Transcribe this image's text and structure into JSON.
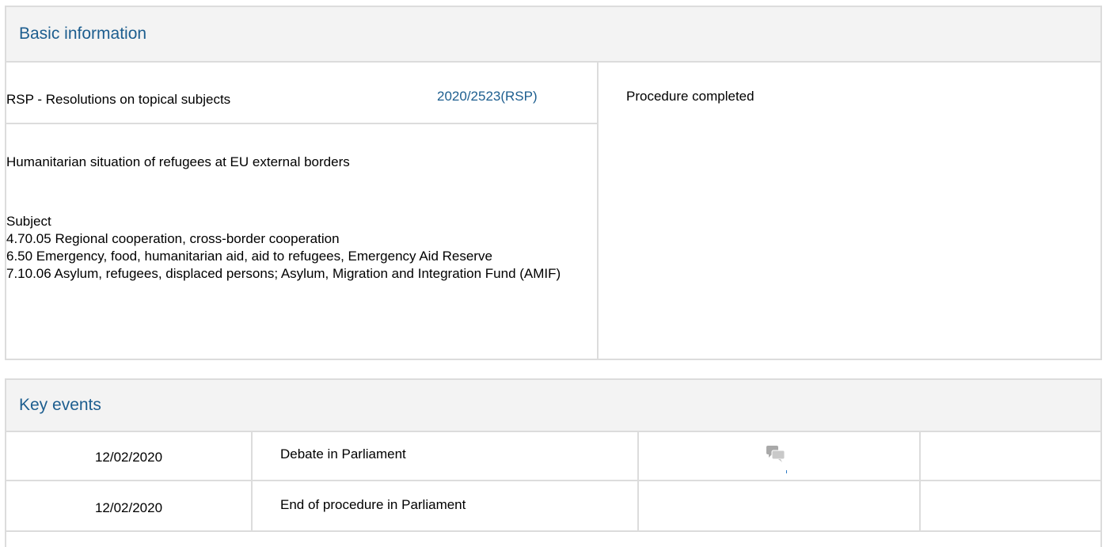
{
  "basic_information": {
    "header": "Basic information",
    "procedure_type": "RSP - Resolutions on topical subjects",
    "reference": "2020/2523(RSP)",
    "status": "Procedure completed",
    "title": "Humanitarian situation of refugees at EU external borders",
    "subject_label": "Subject",
    "subjects": [
      "4.70.05 Regional cooperation, cross-border cooperation",
      "6.50 Emergency, food, humanitarian aid, aid to refugees, Emergency Aid Reserve",
      "7.10.06 Asylum, refugees, displaced persons; Asylum, Migration and Integration Fund (AMIF)"
    ]
  },
  "key_events": {
    "header": "Key events",
    "rows": [
      {
        "date": "12/02/2020",
        "event": "Debate in Parliament",
        "document_icon": "debate-speech-bubbles-icon"
      },
      {
        "date": "12/02/2020",
        "event": "End of procedure in Parliament",
        "document_icon": ""
      }
    ]
  },
  "colors": {
    "accent": "#1d5e8f",
    "header_bg": "#f3f3f3",
    "border": "#dcdcdc"
  }
}
